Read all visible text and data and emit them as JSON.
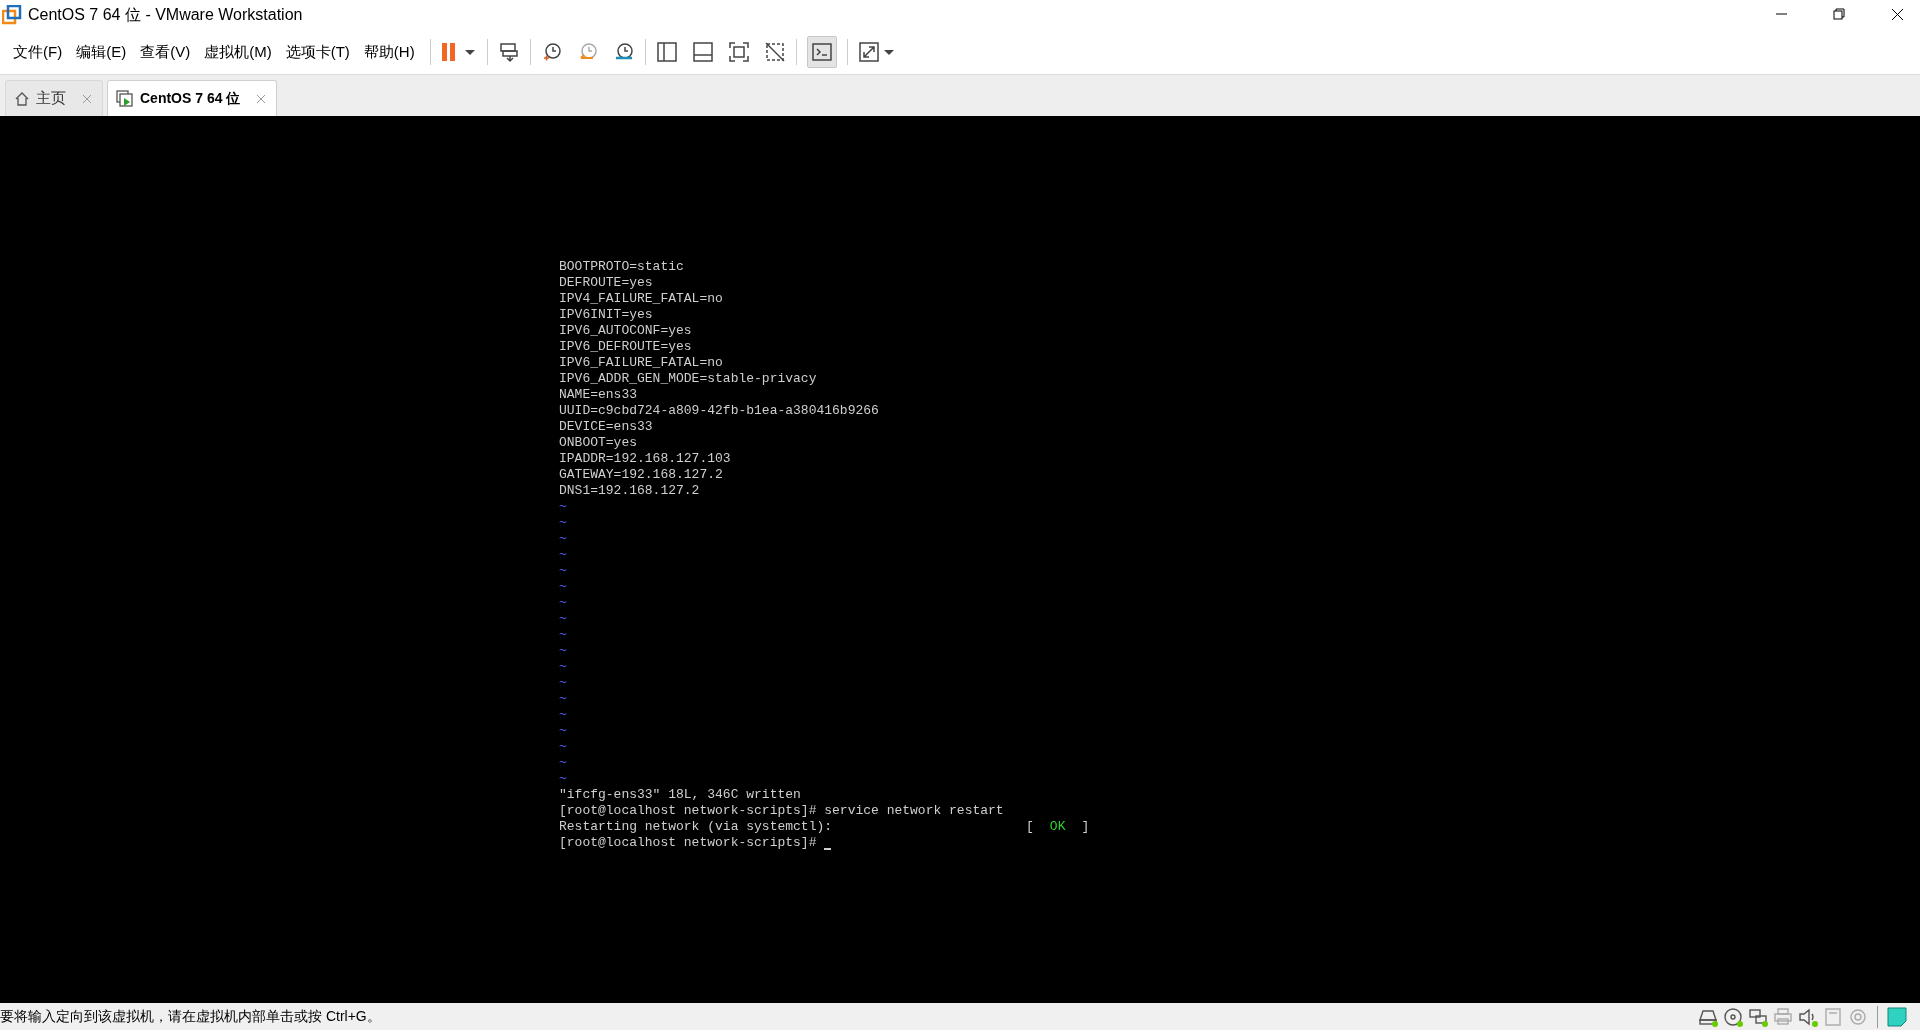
{
  "window": {
    "title": "CentOS 7 64 位 - VMware Workstation"
  },
  "menu": [
    "文件(F)",
    "编辑(E)",
    "查看(V)",
    "虚拟机(M)",
    "选项卡(T)",
    "帮助(H)"
  ],
  "toolbar": {
    "console_view_active": true
  },
  "tabs": [
    {
      "label": "主页",
      "kind": "home",
      "selected": false
    },
    {
      "label": "CentOS 7 64 位",
      "kind": "vm",
      "selected": true
    }
  ],
  "terminal": {
    "lines": [
      {
        "kind": "text",
        "text": "BOOTPROTO=static"
      },
      {
        "kind": "text",
        "text": "DEFROUTE=yes"
      },
      {
        "kind": "text",
        "text": "IPV4_FAILURE_FATAL=no"
      },
      {
        "kind": "text",
        "text": "IPV6INIT=yes"
      },
      {
        "kind": "text",
        "text": "IPV6_AUTOCONF=yes"
      },
      {
        "kind": "text",
        "text": "IPV6_DEFROUTE=yes"
      },
      {
        "kind": "text",
        "text": "IPV6_FAILURE_FATAL=no"
      },
      {
        "kind": "text",
        "text": "IPV6_ADDR_GEN_MODE=stable-privacy"
      },
      {
        "kind": "text",
        "text": "NAME=ens33"
      },
      {
        "kind": "text",
        "text": "UUID=c9cbd724-a809-42fb-b1ea-a380416b9266"
      },
      {
        "kind": "text",
        "text": "DEVICE=ens33"
      },
      {
        "kind": "text",
        "text": "ONBOOT=yes"
      },
      {
        "kind": "text",
        "text": "IPADDR=192.168.127.103"
      },
      {
        "kind": "text",
        "text": "GATEWAY=192.168.127.2"
      },
      {
        "kind": "text",
        "text": "DNS1=192.168.127.2"
      },
      {
        "kind": "tilde",
        "text": "~"
      },
      {
        "kind": "tilde",
        "text": "~"
      },
      {
        "kind": "tilde",
        "text": "~"
      },
      {
        "kind": "tilde",
        "text": "~"
      },
      {
        "kind": "tilde",
        "text": "~"
      },
      {
        "kind": "tilde",
        "text": "~"
      },
      {
        "kind": "tilde",
        "text": "~"
      },
      {
        "kind": "tilde",
        "text": "~"
      },
      {
        "kind": "tilde",
        "text": "~"
      },
      {
        "kind": "tilde",
        "text": "~"
      },
      {
        "kind": "tilde",
        "text": "~"
      },
      {
        "kind": "tilde",
        "text": "~"
      },
      {
        "kind": "tilde",
        "text": "~"
      },
      {
        "kind": "tilde",
        "text": "~"
      },
      {
        "kind": "tilde",
        "text": "~"
      },
      {
        "kind": "tilde",
        "text": "~"
      },
      {
        "kind": "tilde",
        "text": "~"
      },
      {
        "kind": "tilde",
        "text": "~"
      },
      {
        "kind": "text",
        "text": "\"ifcfg-ens33\" 18L, 346C written"
      },
      {
        "kind": "text",
        "text": "[root@localhost network-scripts]# service network restart"
      },
      {
        "kind": "status",
        "text": "Restarting network (via systemctl):",
        "open": "[",
        "result": "OK",
        "close": "]"
      },
      {
        "kind": "prompt",
        "text": "[root@localhost network-scripts]#"
      }
    ]
  },
  "status_bar": {
    "message": "要将输入定向到该虚拟机，请在虚拟机内部单击或按 Ctrl+G。",
    "devices": [
      {
        "kind": "disk",
        "connected": true
      },
      {
        "kind": "cd",
        "connected": true
      },
      {
        "kind": "network",
        "connected": true
      },
      {
        "kind": "printer",
        "connected": false
      },
      {
        "kind": "sound",
        "connected": true
      },
      {
        "kind": "floppy",
        "connected": false
      },
      {
        "kind": "camera",
        "connected": false
      }
    ]
  }
}
